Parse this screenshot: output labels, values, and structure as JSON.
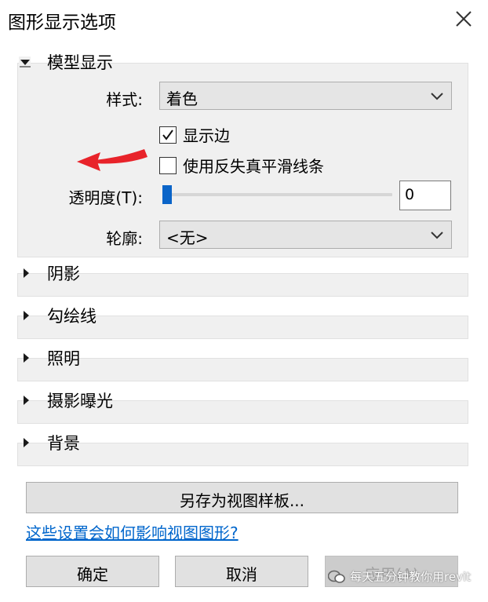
{
  "window": {
    "title": "图形显示选项"
  },
  "model_display": {
    "header": "模型显示",
    "style_label": "样式:",
    "style_value": "着色",
    "show_edges_label": "显示边",
    "show_edges_checked": true,
    "antialias_label": "使用反失真平滑线条",
    "antialias_checked": false,
    "transparency_label": "透明度(T):",
    "transparency_value": "0",
    "transparency_level": 0,
    "silhouette_label": "轮廓:",
    "silhouette_value": "<无>"
  },
  "sections": [
    {
      "label": "阴影"
    },
    {
      "label": "勾绘线"
    },
    {
      "label": "照明"
    },
    {
      "label": "摄影曝光"
    },
    {
      "label": "背景"
    }
  ],
  "buttons": {
    "save_template": "另存为视图样板...",
    "ok": "确定",
    "cancel": "取消",
    "apply": "应用(A)"
  },
  "help_link": "这些设置会如何影响视图图形?",
  "watermark": "每天五分钟教你用revit",
  "colors": {
    "accent": "#0a64c8",
    "arrow": "#e8232a",
    "link": "#0066cc"
  }
}
